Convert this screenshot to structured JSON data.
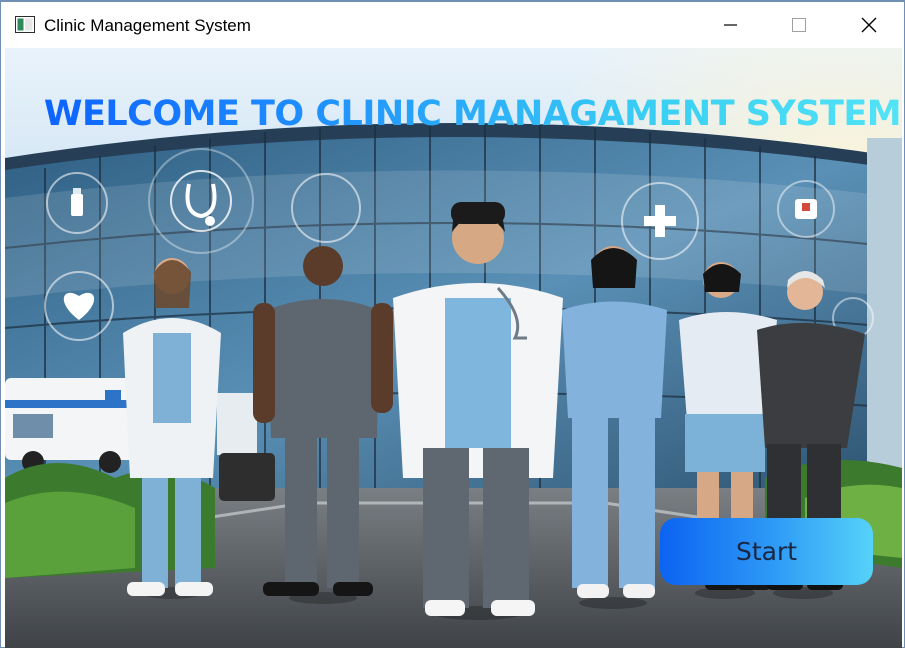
{
  "window": {
    "title": "Clinic Management System",
    "controls": [
      "minimize-icon",
      "maximize-icon",
      "close-icon"
    ]
  },
  "main": {
    "heading": "WELCOME TO CLINIC MANAGAMENT SYSTEM",
    "start_label": "Start"
  },
  "colors": {
    "heading_gradient": [
      "#0a5cff",
      "#56e6f6"
    ],
    "button_gradient": [
      "#0c63f2",
      "#56d2f8"
    ],
    "button_text": "#1b2742"
  },
  "background_illustration": {
    "subject": "clinic-building-with-medical-staff",
    "icons": [
      "stethoscope-icon",
      "heart-icon",
      "medicine-bottle-icon",
      "medical-cross-icon",
      "ambulance-icon"
    ]
  }
}
